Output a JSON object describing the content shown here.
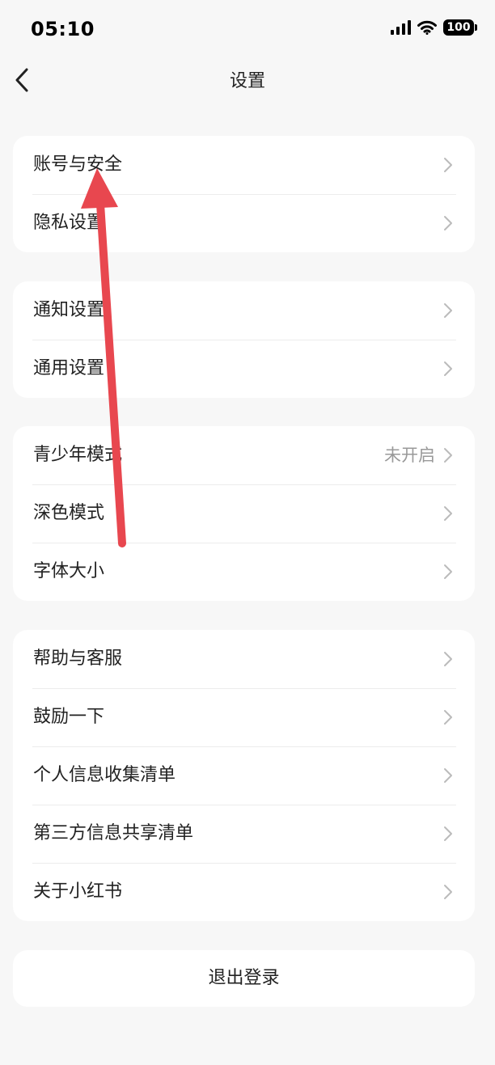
{
  "status_bar": {
    "time": "05:10",
    "battery": "100"
  },
  "header": {
    "title": "设置"
  },
  "groups": [
    {
      "items": [
        {
          "label": "账号与安全"
        },
        {
          "label": "隐私设置"
        }
      ]
    },
    {
      "items": [
        {
          "label": "通知设置"
        },
        {
          "label": "通用设置"
        }
      ]
    },
    {
      "items": [
        {
          "label": "青少年模式",
          "value": "未开启"
        },
        {
          "label": "深色模式"
        },
        {
          "label": "字体大小"
        }
      ]
    },
    {
      "items": [
        {
          "label": "帮助与客服"
        },
        {
          "label": "鼓励一下"
        },
        {
          "label": "个人信息收集清单"
        },
        {
          "label": "第三方信息共享清单"
        },
        {
          "label": "关于小红书"
        }
      ]
    }
  ],
  "logout": {
    "label": "退出登录"
  },
  "annotation": {
    "color": "#e8474f"
  }
}
